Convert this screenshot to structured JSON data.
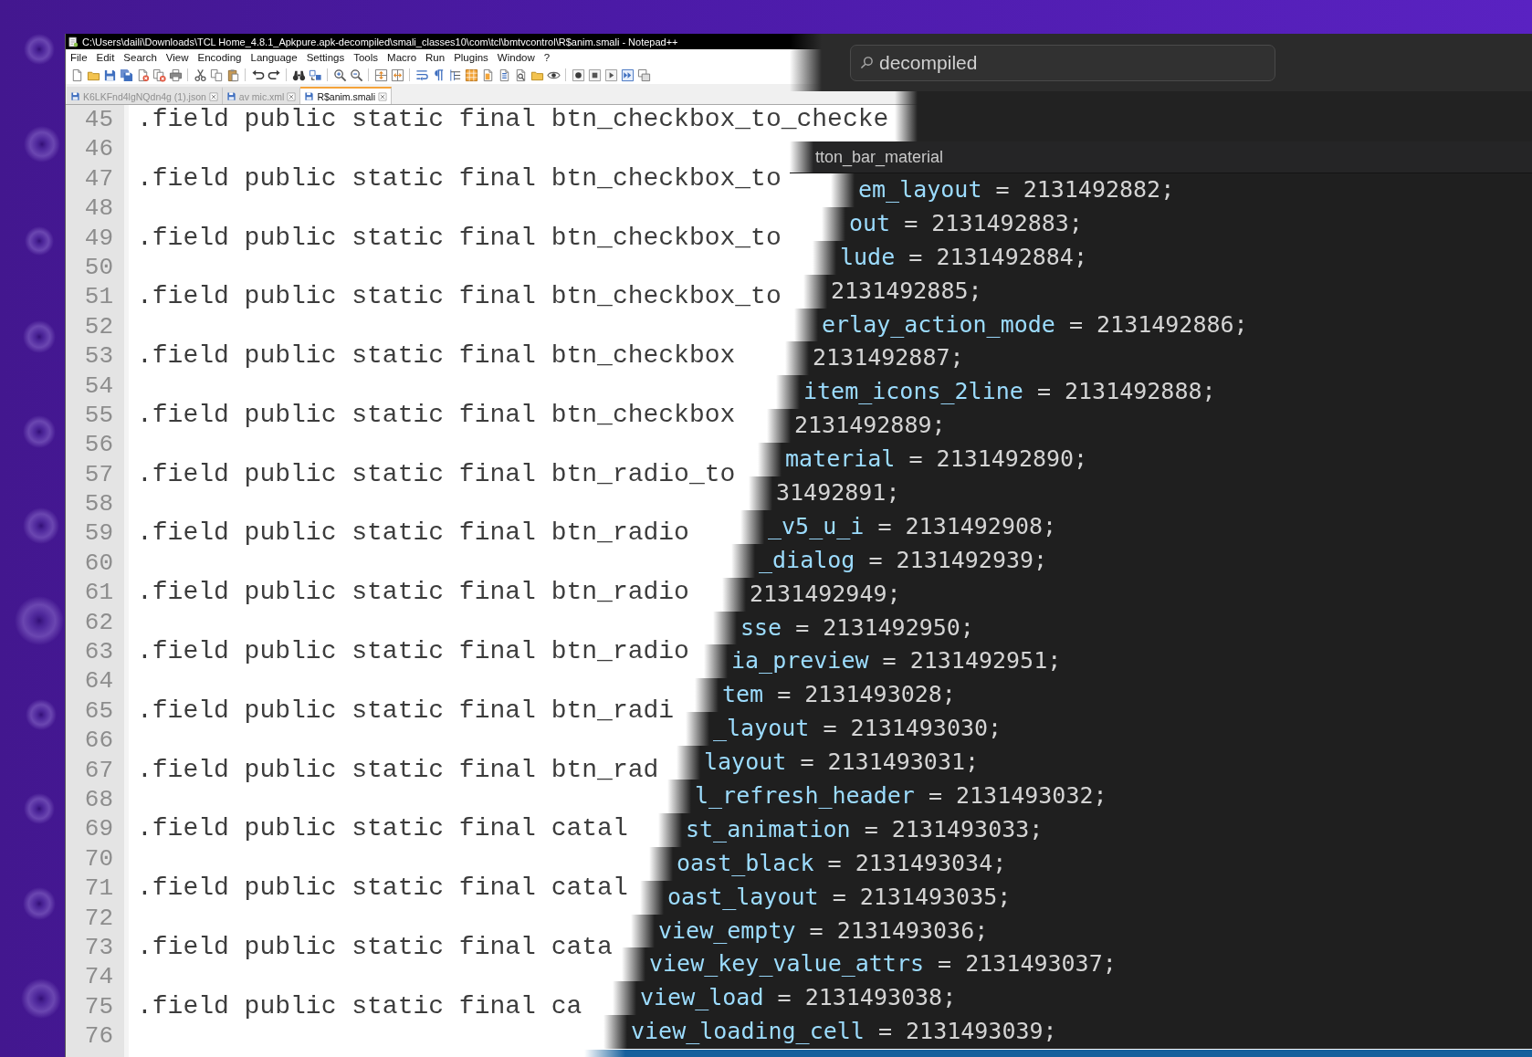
{
  "notepad_window": {
    "title": "C:\\Users\\daili\\Downloads\\TCL Home_4.8.1_Apkpure.apk-decompiled\\smali_classes10\\com\\tcl\\bmtvcontrol\\R$anim.smali - Notepad++",
    "menu": [
      "File",
      "Edit",
      "Search",
      "View",
      "Encoding",
      "Language",
      "Settings",
      "Tools",
      "Macro",
      "Run",
      "Plugins",
      "Window",
      "?"
    ],
    "tabs": [
      {
        "label": "K6LKFnd4lgNQdn4g (1).json",
        "selected": false
      },
      {
        "label": "av mic.xml",
        "selected": false
      },
      {
        "label": "R$anim.smali",
        "selected": true
      }
    ],
    "lines": [
      {
        "number": "45",
        "text": ".field public static final btn_checkbox_to_checke"
      },
      {
        "number": "46"
      },
      {
        "number": "47",
        "text": ".field public static final btn_checkbox_to"
      },
      {
        "number": "48"
      },
      {
        "number": "49",
        "text": ".field public static final btn_checkbox_to"
      },
      {
        "number": "50"
      },
      {
        "number": "51",
        "text": ".field public static final btn_checkbox_to"
      },
      {
        "number": "52"
      },
      {
        "number": "53",
        "text": ".field public static final btn_checkbox"
      },
      {
        "number": "54"
      },
      {
        "number": "55",
        "text": ".field public static final btn_checkbox"
      },
      {
        "number": "56"
      },
      {
        "number": "57",
        "text": ".field public static final btn_radio_to"
      },
      {
        "number": "58"
      },
      {
        "number": "59",
        "text": ".field public static final btn_radio"
      },
      {
        "number": "60"
      },
      {
        "number": "61",
        "text": ".field public static final btn_radio"
      },
      {
        "number": "62"
      },
      {
        "number": "63",
        "text": ".field public static final btn_radio"
      },
      {
        "number": "64"
      },
      {
        "number": "65",
        "text": ".field public static final btn_radi"
      },
      {
        "number": "66"
      },
      {
        "number": "67",
        "text": ".field public static final btn_rad"
      },
      {
        "number": "68"
      },
      {
        "number": "69",
        "text": ".field public static final catal"
      },
      {
        "number": "70"
      },
      {
        "number": "71",
        "text": ".field public static final catal"
      },
      {
        "number": "72"
      },
      {
        "number": "73",
        "text": ".field public static final cata"
      },
      {
        "number": "74"
      },
      {
        "number": "75",
        "text": ".field public static final ca"
      },
      {
        "number": "76"
      }
    ]
  },
  "dark_editor": {
    "search": {
      "value": "decompiled"
    },
    "sticky_header": "tton_bar_material",
    "lines": [
      {
        "identifier": "em_layout",
        "value": "= 2131492882;"
      },
      {
        "identifier": "out",
        "value": "= 2131492883;"
      },
      {
        "identifier": "lude",
        "value": "= 2131492884;"
      },
      {
        "value": "2131492885;"
      },
      {
        "identifier": "erlay_action_mode",
        "value": "= 2131492886;"
      },
      {
        "value": "2131492887;"
      },
      {
        "identifier": "item_icons_2line",
        "value": "= 2131492888;"
      },
      {
        "value": "2131492889;"
      },
      {
        "identifier": "material",
        "value": "= 2131492890;"
      },
      {
        "value": "31492891;"
      },
      {
        "identifier": "_v5_u_i",
        "value": "= 2131492908;"
      },
      {
        "identifier": "_dialog",
        "value": "= 2131492939;"
      },
      {
        "value": "2131492949;"
      },
      {
        "identifier": "sse",
        "value": "= 2131492950;"
      },
      {
        "identifier": "ia_preview",
        "value": "= 2131492951;"
      },
      {
        "identifier": "tem",
        "value": "= 2131493028;"
      },
      {
        "identifier": "_layout",
        "value": "= 2131493030;"
      },
      {
        "identifier": "layout",
        "value": "= 2131493031;"
      },
      {
        "identifier": "l_refresh_header",
        "value": "= 2131493032;"
      },
      {
        "identifier": "st_animation",
        "value": "= 2131493033;"
      },
      {
        "identifier": "oast_black",
        "value": "= 2131493034;"
      },
      {
        "identifier": "oast_layout",
        "value": "= 2131493035;"
      },
      {
        "identifier": "view_empty",
        "value": "= 2131493036;"
      },
      {
        "identifier": "view_key_value_attrs",
        "value": "= 2131493037;"
      },
      {
        "identifier": "view_load",
        "value": "= 2131493038;"
      },
      {
        "identifier": "view_loading_cell",
        "value": "= 2131493039;"
      }
    ]
  }
}
